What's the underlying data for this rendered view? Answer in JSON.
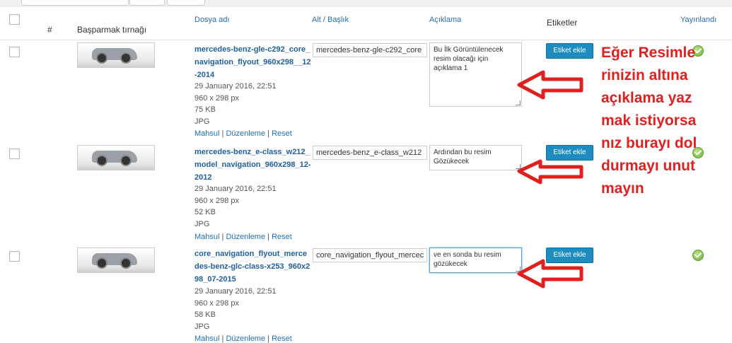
{
  "header": {
    "num": "#",
    "thumb": "Başparmak tırnağı",
    "filename": "Dosya adı",
    "alt_title": "Alt / Başlık",
    "description": "Açıklama",
    "tags": "Etiketler",
    "published": "Yayınlandı"
  },
  "rows": [
    {
      "filename": "mercedes-benz-gle-c292_core_navigation_flyout_960x298__12-2014",
      "date": "29 January 2016, 22:51",
      "dimensions": "960 x 298 px",
      "size": "75 KB",
      "type": "JPG",
      "alt_value": "mercedes-benz-gle-c292_core",
      "description": "Bu İlk Görüntülenecek resim olacağı için açıklama 1",
      "tag_button": "Etiket ekle"
    },
    {
      "filename": "mercedes-benz_e-class_w212_model_navigation_960x298_12-2012",
      "date": "29 January 2016, 22:51",
      "dimensions": "960 x 298 px",
      "size": "52 KB",
      "type": "JPG",
      "alt_value": "mercedes-benz_e-class_w212",
      "description": "Ardından bu resim Gözükecek",
      "tag_button": "Etiket ekle"
    },
    {
      "filename": "core_navigation_flyout_mercedes-benz-glc-class-x253_960x298_07-2015",
      "date": "29 January 2016, 22:51",
      "dimensions": "960 x 298 px",
      "size": "58 KB",
      "type": "JPG",
      "alt_value": "core_navigation_flyout_mercec",
      "description": "ve en sonda bu resim gözükecek",
      "tag_button": "Etiket ekle"
    }
  ],
  "actions": {
    "mahsul": "Mahsul",
    "duzenleme": "Düzenleme",
    "reset": "Reset",
    "sep": "|"
  },
  "annotation": "Eğer Resimlerinizin altına açıklama yazmak istiyorsanız burayı doldurmayı unutmayın",
  "colors": {
    "link": "#2271b1",
    "button": "#1e8cbe",
    "annotation": "#e0201f",
    "published": "#6fb33a"
  },
  "icons": [
    "checkbox",
    "car-thumbnail",
    "published-check-icon",
    "red-arrow-icon"
  ]
}
